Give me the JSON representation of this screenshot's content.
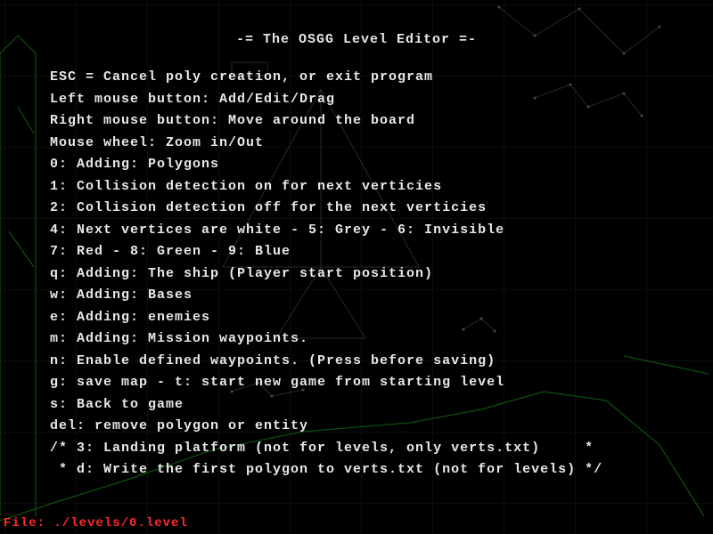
{
  "title": "-= The OSGG Level Editor =-",
  "lines": [
    "ESC = Cancel poly creation, or exit program",
    "Left mouse button: Add/Edit/Drag",
    "Right mouse button: Move around the board",
    "Mouse wheel: Zoom in/Out",
    "0: Adding: Polygons",
    "1: Collision detection on for next verticies",
    "2: Collision detection off for the next verticies",
    "4: Next vertices are white - 5: Grey - 6: Invisible",
    "7: Red - 8: Green - 9: Blue",
    "q: Adding: The ship (Player start position)",
    "w: Adding: Bases",
    "e: Adding: enemies",
    "m: Adding: Mission waypoints.",
    "n: Enable defined waypoints. (Press before saving)",
    "g: save map - t: start new game from starting level",
    "s: Back to game",
    "del: remove polygon or entity",
    "/* 3: Landing platform (not for levels, only verts.txt)     *",
    " * d: Write the first polygon to verts.txt (not for levels) */"
  ],
  "file_label": "File: ./levels/0.level"
}
